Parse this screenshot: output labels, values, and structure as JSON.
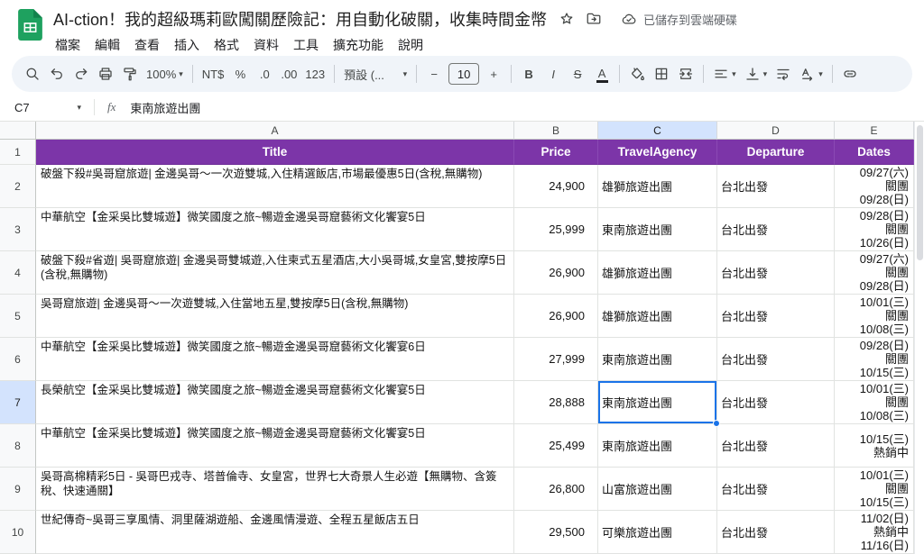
{
  "colors": {
    "header_purple": "#7c35a8",
    "selection_blue": "#1a73e8",
    "selected_header_bg": "#d3e3fd",
    "logo_green": "#1ea15f",
    "toolbar_bg": "#f0f4f9"
  },
  "glyphs": {
    "caret": "▾"
  },
  "header": {
    "title": "AI-ction！我的超級瑪莉歐闖關歷險記：用自動化破關，收集時間金幣",
    "saved_status": "已儲存到雲端硬碟",
    "menus": [
      "檔案",
      "編輯",
      "查看",
      "插入",
      "格式",
      "資料",
      "工具",
      "擴充功能",
      "說明"
    ]
  },
  "toolbar": {
    "zoom": "100%",
    "currency": "NT$",
    "percent": "%",
    "decrease_decimal": ".0",
    "increase_decimal": ".00",
    "more_formats": "123",
    "font_name": "預設 (...",
    "decrease_font": "−",
    "font_size": "10",
    "increase_font": "+",
    "bold": "B",
    "italic": "I",
    "strikethrough": "S",
    "text_color": "A"
  },
  "formula_bar": {
    "cell_ref": "C7",
    "fx": "fx",
    "value": "東南旅遊出團"
  },
  "sheet": {
    "col_letters": [
      "A",
      "B",
      "C",
      "D",
      "E"
    ],
    "header_row": {
      "num": "1",
      "title": "Title",
      "price": "Price",
      "agency": "TravelAgency",
      "departure": "Departure",
      "dates": "Dates"
    },
    "rows": [
      {
        "num": "2",
        "title": "破盤下殺#吳哥窟旅遊| 金邊吳哥～一次遊雙城,入住精選飯店,市場最優惠5日(含稅,無購物)",
        "price": "24,900",
        "agency": "雄獅旅遊出團",
        "departure": "台北出發",
        "dates": "09/27(六)\n關團\n09/28(日)"
      },
      {
        "num": "3",
        "title": "中華航空【金采吳比雙城遊】微笑國度之旅~暢遊金邊吳哥窟藝術文化饗宴5日",
        "price": "25,999",
        "agency": "東南旅遊出團",
        "departure": "台北出發",
        "dates": "09/28(日)\n關團\n10/26(日)"
      },
      {
        "num": "4",
        "title": "破盤下殺#省遊| 吳哥窟旅遊| 金邊吳哥雙城遊,入住柬式五星酒店,大小吳哥城,女皇宮,雙按摩5日(含稅,無購物)",
        "price": "26,900",
        "agency": "雄獅旅遊出團",
        "departure": "台北出發",
        "dates": "09/27(六)\n關團\n09/28(日)"
      },
      {
        "num": "5",
        "title": "吳哥窟旅遊| 金邊吳哥～一次遊雙城,入住當地五星,雙按摩5日(含稅,無購物)",
        "price": "26,900",
        "agency": "雄獅旅遊出團",
        "departure": "台北出發",
        "dates": "10/01(三)\n關團\n10/08(三)"
      },
      {
        "num": "6",
        "title": "中華航空【金采吳比雙城遊】微笑國度之旅~暢遊金邊吳哥窟藝術文化饗宴6日",
        "price": "27,999",
        "agency": "東南旅遊出團",
        "departure": "台北出發",
        "dates": "09/28(日)\n關團\n10/15(三)"
      },
      {
        "num": "7",
        "title": "長榮航空【金采吳比雙城遊】微笑國度之旅~暢遊金邊吳哥窟藝術文化饗宴5日",
        "price": "28,888",
        "agency": "東南旅遊出團",
        "departure": "台北出發",
        "dates": "10/01(三)\n關團\n10/08(三)"
      },
      {
        "num": "8",
        "title": "中華航空【金采吳比雙城遊】微笑國度之旅~暢遊金邊吳哥窟藝術文化饗宴5日",
        "price": "25,499",
        "agency": "東南旅遊出團",
        "departure": "台北出發",
        "dates": "10/15(三)\n熱銷中"
      },
      {
        "num": "9",
        "title": "吳哥高棉精彩5日 - 吳哥巴戎寺、塔普倫寺、女皇宮，世界七大奇景人生必遊【無購物、含簽稅、快速通關】",
        "price": "26,800",
        "agency": "山富旅遊出團",
        "departure": "台北出發",
        "dates": "10/01(三)\n關團\n10/15(三)"
      },
      {
        "num": "10",
        "title": "世紀傳奇~吳哥三享風情、洞里薩湖遊船、金邊風情漫遊、全程五星飯店五日",
        "price": "29,500",
        "agency": "可樂旅遊出團",
        "departure": "台北出發",
        "dates": "11/02(日)\n熱銷中\n11/16(日)"
      }
    ]
  }
}
